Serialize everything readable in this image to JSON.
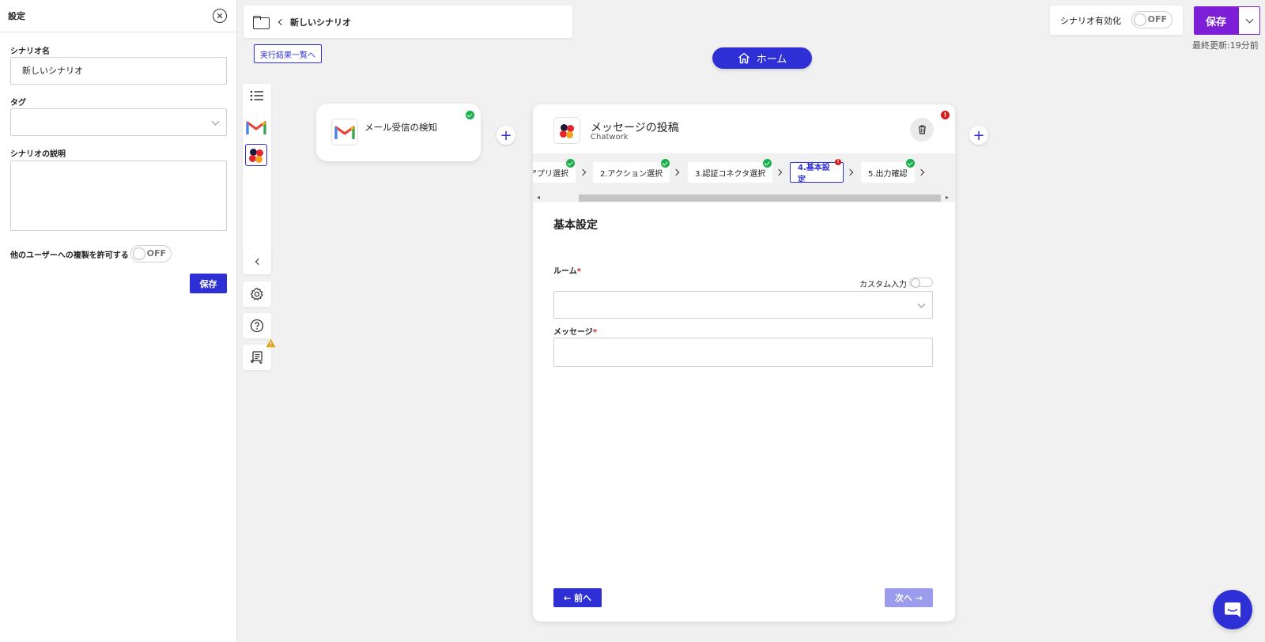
{
  "panel": {
    "title": "設定",
    "scenario_name_label": "シナリオ名",
    "scenario_name_value": "新しいシナリオ",
    "tag_label": "タグ",
    "description_label": "シナリオの説明",
    "allow_copy_label": "他のユーザーへの複製を許可する",
    "allow_copy_toggle": "OFF",
    "save_label": "保存"
  },
  "topbar": {
    "scenario_title": "新しいシナリオ",
    "results_link": "実行結果一覧へ",
    "home_label": "ホーム",
    "enable_label": "シナリオ有効化",
    "enable_toggle": "OFF",
    "save_label": "保存",
    "last_updated": "最終更新:19分前"
  },
  "trigger_node": {
    "title": "メール受信の検知"
  },
  "action_card": {
    "title": "メッセージの投稿",
    "app_name": "Chatwork",
    "steps": [
      {
        "label": "アプリ選択"
      },
      {
        "label": "2.アクション選択"
      },
      {
        "label": "3.認証コネクタ選択"
      },
      {
        "label": "4.基本設定"
      },
      {
        "label": "5.出力確認"
      }
    ],
    "section_title": "基本設定",
    "room_label": "ルーム",
    "required_mark": "*",
    "custom_input_label": "カスタム入力",
    "message_label": "メッセージ",
    "prev_label": "← 前へ",
    "next_label": "次へ →"
  },
  "colors": {
    "primary": "#2f2fd6",
    "save_top": "#7c1fd6",
    "success": "#19b04a",
    "error": "#d21d1d",
    "warning": "#e0a20e"
  }
}
